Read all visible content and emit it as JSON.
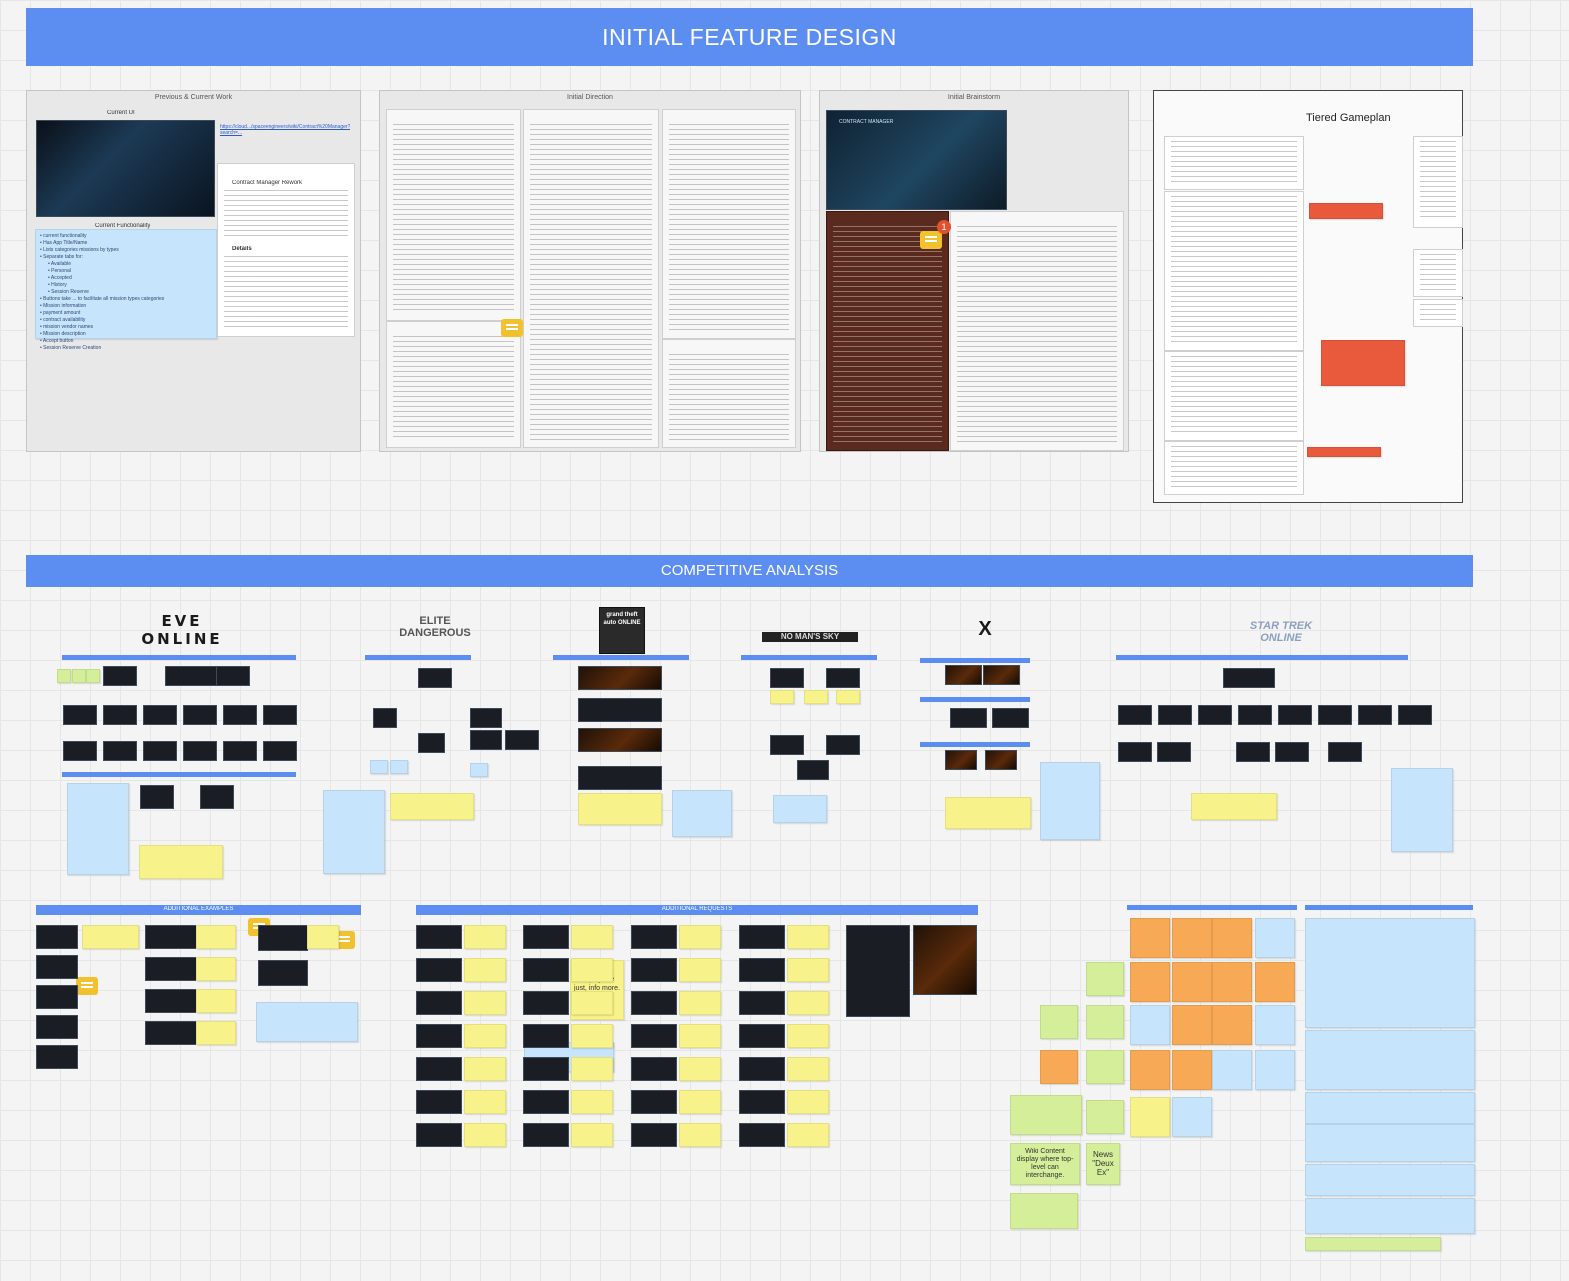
{
  "banners": {
    "initial": "INITIAL FEATURE DESIGN",
    "competitive": "COMPETITIVE ANALYSIS"
  },
  "frames": {
    "previous": "Previous & Current Work",
    "direction": "Initial Direction",
    "brainstorm": "Initial Brainstorm",
    "gameplan": "Tiered Gameplan"
  },
  "previous": {
    "current_ui": "Current UI",
    "link": "https://cloud.../spaceengineers/wiki/Contract%20Manager?search=...",
    "current_functionality": "Current Functionality",
    "doc_title": "Contract Manager Rework",
    "doc_heading": "Details",
    "func_items": [
      "current functionality",
      "Has App Title/Name",
      "Lists categories missions by types",
      "Separate tabs for:",
      "Available",
      "Personal",
      "Accepted",
      "History",
      "Session Reserve",
      "Buttons take ... to facilitate all mission types categories",
      "Mission information",
      "payment amount",
      "contract availability",
      "mission vendor names",
      "Mission description",
      "Accept button",
      "Session Reserve Creation"
    ]
  },
  "brainstorm": {
    "shot_title": "CONTRACT MANAGER",
    "badge": "1"
  },
  "logos": [
    "EVE ONLINE",
    "ELITE DANGEROUS",
    "grand theft auto ONLINE",
    "NO MAN'S SKY",
    "X",
    "STAR TREK ONLINE"
  ],
  "sections": {
    "additional_examples": "ADDITIONAL EXAMPLES",
    "additional_requests": "ADDITIONAL REQUESTS"
  },
  "stickies": {
    "wiki_content": "Wiki Content display where top-level can interchange.",
    "news": "News \"Deux Ex\"",
    "chat_play": "chat play are just, info more."
  }
}
